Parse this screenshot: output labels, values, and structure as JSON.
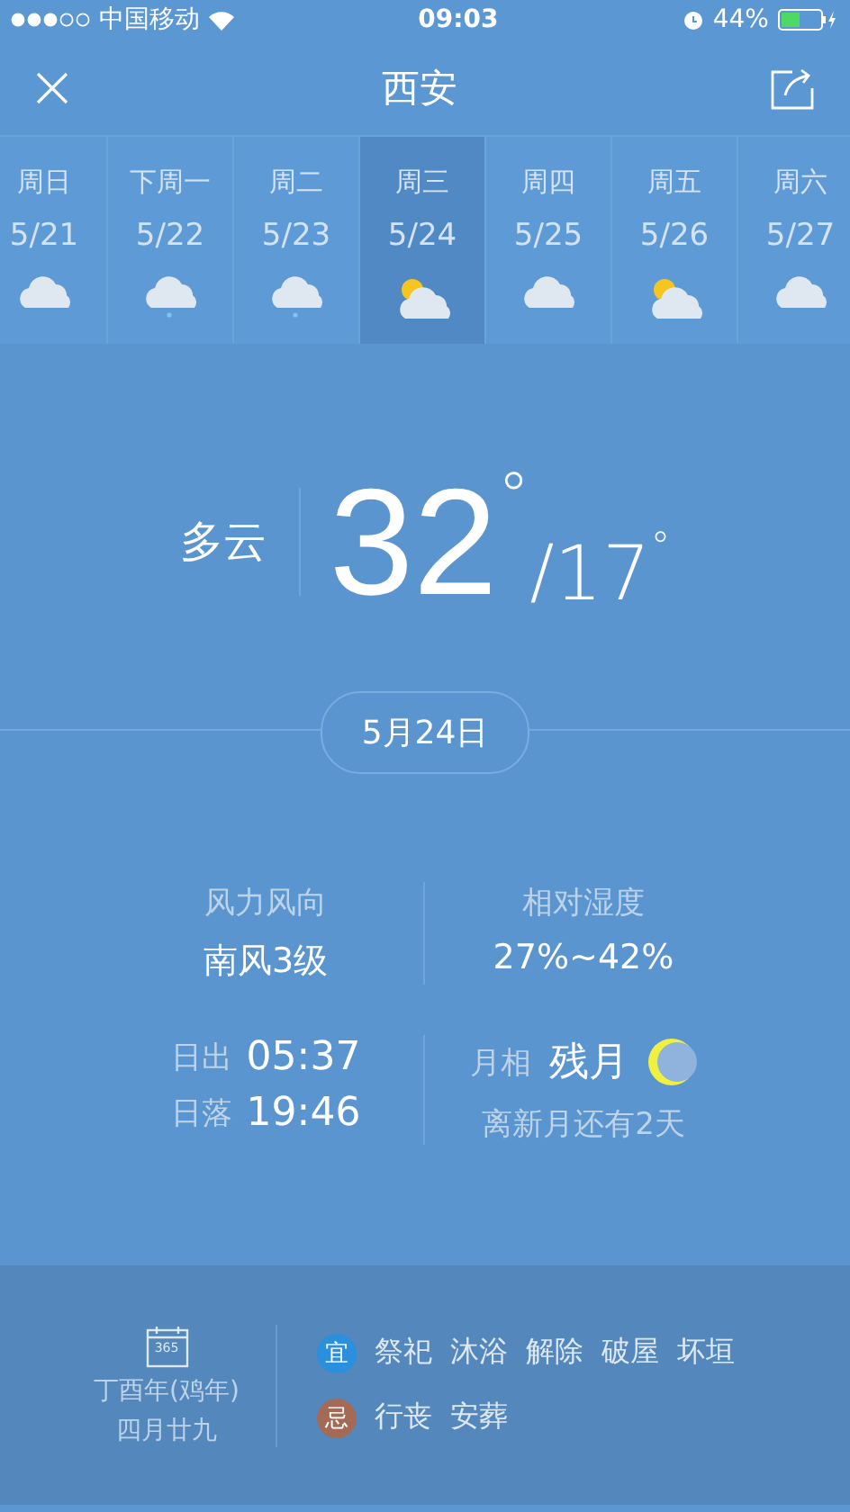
{
  "status_bar": {
    "carrier": "中国移动",
    "time": "09:03",
    "battery": "44%"
  },
  "header": {
    "title": "西安"
  },
  "days": [
    {
      "weekday": "周日",
      "date": "5/21",
      "kind": "cloudy",
      "selected": false
    },
    {
      "weekday": "下周一",
      "date": "5/22",
      "kind": "rain",
      "selected": false
    },
    {
      "weekday": "周二",
      "date": "5/23",
      "kind": "rain",
      "selected": false
    },
    {
      "weekday": "周三",
      "date": "5/24",
      "kind": "partly",
      "selected": true
    },
    {
      "weekday": "周四",
      "date": "5/25",
      "kind": "cloudy",
      "selected": false
    },
    {
      "weekday": "周五",
      "date": "5/26",
      "kind": "partly",
      "selected": false
    },
    {
      "weekday": "周六",
      "date": "5/27",
      "kind": "cloudy",
      "selected": false
    }
  ],
  "today": {
    "condition": "多云",
    "high": "32",
    "high_unit": "°",
    "separator": "/",
    "low": "17",
    "low_unit": "°",
    "date": "5月24日"
  },
  "details": {
    "wind_label": "风力风向",
    "wind": "南风3级",
    "humidity_label": "相对湿度",
    "humidity": "27%~42%",
    "sunrise_label": "日出",
    "sunrise": "05:37",
    "sunset_label": "日落",
    "sunset": "19:46",
    "moon_label": "月相",
    "moon": "残月",
    "moon_note": "离新月还有2天"
  },
  "almanac": {
    "year": "丁酉年(鸡年)",
    "lunar_date": "四月廿九",
    "calendar_icon_text": "365",
    "rows": [
      {
        "badge": "宜",
        "color": "#2a8fdc",
        "items": [
          "祭祀",
          "沐浴",
          "解除",
          "破屋",
          "坏垣"
        ]
      },
      {
        "badge": "忌",
        "color": "#a46a55",
        "items": [
          "行丧",
          "安葬"
        ]
      }
    ]
  }
}
